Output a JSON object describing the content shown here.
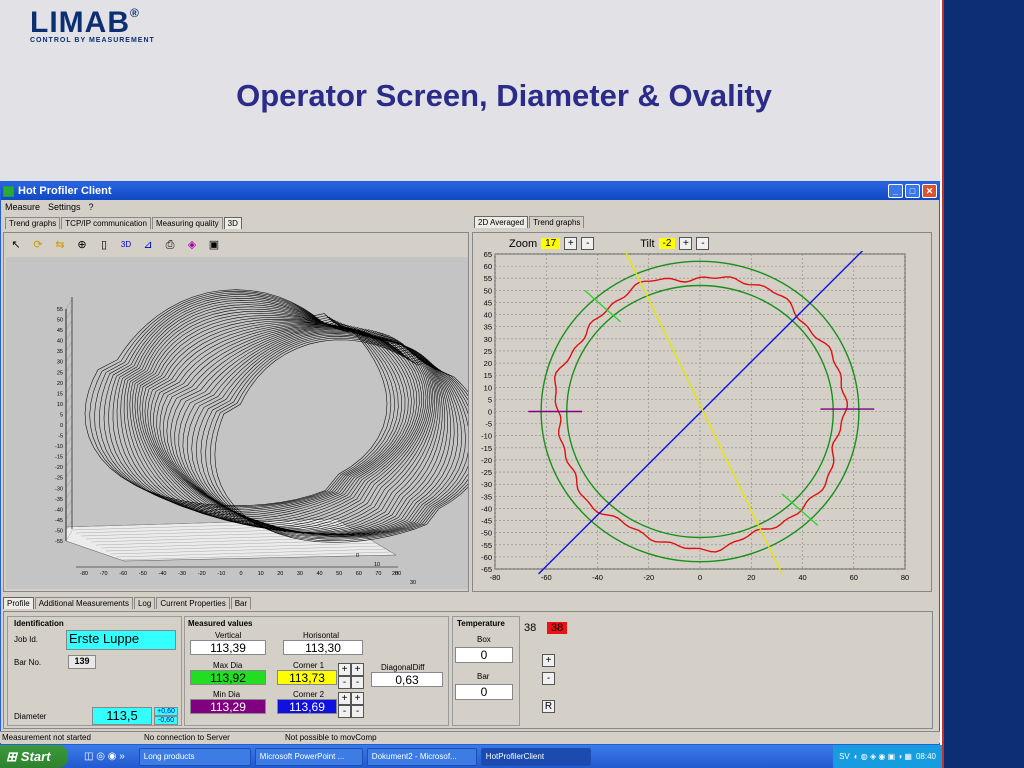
{
  "slide": {
    "logo": "LIMAB",
    "logo_reg": "®",
    "tagline": "CONTROL BY MEASUREMENT",
    "title": "Operator Screen, Diameter & Ovality"
  },
  "window": {
    "title": "Hot Profiler Client",
    "menu": [
      "Measure",
      "Settings",
      "?"
    ],
    "left_tabs": [
      "Trend graphs",
      "TCP/IP communication",
      "Measuring quality",
      "3D"
    ],
    "right_tabs": [
      "2D Averaged",
      "Trend graphs"
    ],
    "toolbar_icons": [
      "pointer-icon",
      "rotate-icon",
      "pan-icon",
      "zoom-icon",
      "page-icon",
      "3d-icon",
      "axes-icon",
      "print-icon",
      "palette-icon",
      "save-icon"
    ],
    "toolbar_3d_label": "3D"
  },
  "view3d": {
    "y_ticks": [
      "55",
      "50",
      "45",
      "40",
      "35",
      "30",
      "25",
      "20",
      "15",
      "10",
      "5",
      "0",
      "-5",
      "-10",
      "-15",
      "-20",
      "-25",
      "-30",
      "-35",
      "-40",
      "-45",
      "-50",
      "-55"
    ],
    "x_ticks": [
      "-80",
      "-70",
      "-60",
      "-50",
      "-40",
      "-30",
      "-20",
      "-10",
      "0",
      "10",
      "20",
      "30",
      "40",
      "50",
      "60",
      "70",
      "80"
    ],
    "depth_ticks": [
      "0",
      "10",
      "20",
      "30",
      "40",
      "50"
    ]
  },
  "zoom": {
    "label": "Zoom",
    "value": "17",
    "plus": "+",
    "minus": "-"
  },
  "tilt": {
    "label": "Tilt",
    "value": "-2",
    "plus": "+",
    "minus": "-"
  },
  "chart_data": {
    "type": "line",
    "title": "",
    "xlabel": "",
    "ylabel": "",
    "xlim": [
      -80,
      80
    ],
    "ylim": [
      -65,
      65
    ],
    "x_ticks": [
      -80,
      -60,
      -40,
      -20,
      0,
      20,
      40,
      60,
      80
    ],
    "y_ticks": [
      65,
      60,
      55,
      50,
      45,
      40,
      35,
      30,
      25,
      20,
      15,
      10,
      5,
      0,
      -5,
      -10,
      -15,
      -20,
      -25,
      -30,
      -35,
      -40,
      -45,
      -50,
      -55,
      -60,
      -65
    ],
    "grid": true,
    "series": [
      {
        "color": "#1a8f1a",
        "shape": "circle",
        "cx": 0,
        "cy": 0,
        "r": 62
      },
      {
        "color": "#1a8f1a",
        "shape": "circle",
        "cx": 0,
        "cy": 0,
        "r": 52
      },
      {
        "color": "#e01010",
        "shape": "profile",
        "cx": 0,
        "cy": 0,
        "r": 56
      },
      {
        "color": "#1010e0",
        "shape": "line",
        "points": [
          [
            -63,
            -67
          ],
          [
            65,
            68
          ]
        ]
      },
      {
        "color": "#e6e600",
        "shape": "line",
        "points": [
          [
            -30,
            68
          ],
          [
            32,
            -67
          ]
        ]
      },
      {
        "color": "#30d030",
        "shape": "line",
        "points": [
          [
            -45,
            50
          ],
          [
            -31,
            37
          ]
        ]
      },
      {
        "color": "#30d030",
        "shape": "line",
        "points": [
          [
            32,
            -34
          ],
          [
            46,
            -47
          ]
        ]
      },
      {
        "color": "#800080",
        "shape": "line",
        "points": [
          [
            -67,
            0
          ],
          [
            -46,
            0
          ]
        ]
      },
      {
        "color": "#800080",
        "shape": "line",
        "points": [
          [
            47,
            1
          ],
          [
            68,
            1
          ]
        ]
      }
    ]
  },
  "bottom_tabs": [
    "Profile",
    "Additional Measurements",
    "Log",
    "Current Properties",
    "Bar"
  ],
  "identification": {
    "heading": "Identification",
    "job_label": "Job Id.",
    "job_value": "Erste Luppe",
    "bar_label": "Bar No.",
    "bar_value": "139",
    "diam_label": "Diameter",
    "diam_value": "113,5",
    "tol_plus": "+0,60",
    "tol_minus": "-0,60"
  },
  "measured": {
    "heading": "Measured values",
    "vertical_label": "Vertical",
    "vertical": "113,39",
    "horisontal_label": "Horisontal",
    "horisontal": "113,30",
    "maxdia_label": "Max Dia",
    "maxdia": "113,92",
    "corner1_label": "Corner 1",
    "corner1": "113,73",
    "diagdiff_label": "DiagonalDiff",
    "diagdiff": "0,63",
    "mindia_label": "Min Dia",
    "mindia": "113,29",
    "corner2_label": "Corner 2",
    "corner2": "113,69",
    "plus": "+",
    "minus": "-"
  },
  "temperature": {
    "heading": "Temperature",
    "box_label": "Box",
    "box": "0",
    "bar_label": "Bar",
    "bar": "0"
  },
  "right_ctrl": {
    "v1": "38",
    "v2": "38",
    "plus": "+",
    "minus": "-",
    "r": "R"
  },
  "status": [
    "Measurement not started",
    "No connection to Server",
    "Not possible to movComp"
  ],
  "taskbar": {
    "start": "Start",
    "items": [
      "Long products",
      "Microsoft PowerPoint ...",
      "Dokument2 - Microsof...",
      "HotProfilerClient"
    ],
    "lang": "SV",
    "time": "08:40"
  },
  "colors": {
    "accent_navy": "#0b2f72",
    "title_blue": "#2b2b8a",
    "maxdia": "#22dd22",
    "mindia": "#800080",
    "corner": "#ffff00",
    "corner2": "#1010e0",
    "diam": "#33ffff"
  }
}
